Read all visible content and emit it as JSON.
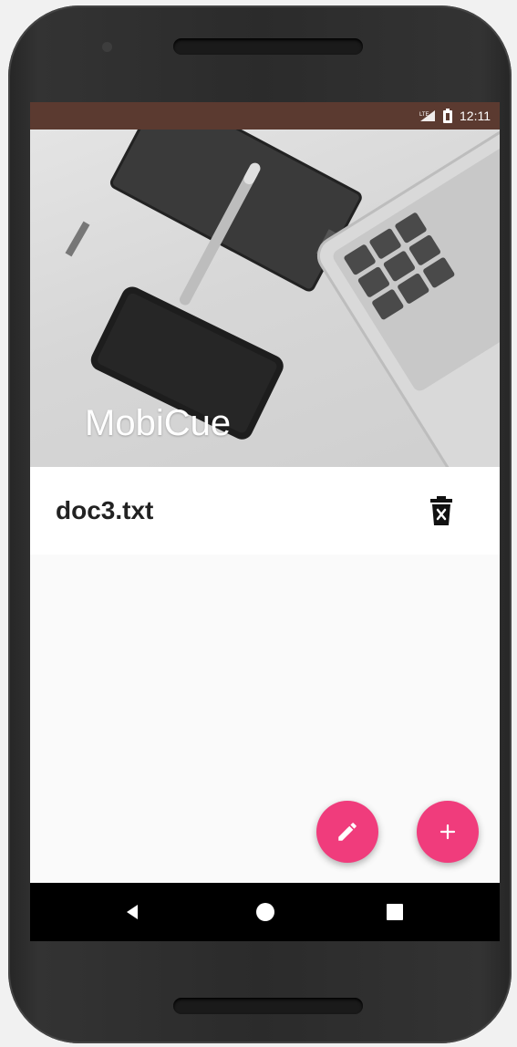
{
  "status_bar": {
    "time": "12:11",
    "background": "#5b3a30"
  },
  "app": {
    "title": "MobiCue"
  },
  "files": [
    {
      "name": "doc3.txt"
    }
  ],
  "icons": {
    "delete": "delete-icon",
    "edit": "pencil-icon",
    "add": "plus-icon",
    "back": "back-triangle-icon",
    "home": "home-circle-icon",
    "recent": "recent-square-icon"
  },
  "colors": {
    "accent": "#f03c7c",
    "nav_bar": "#000000"
  }
}
